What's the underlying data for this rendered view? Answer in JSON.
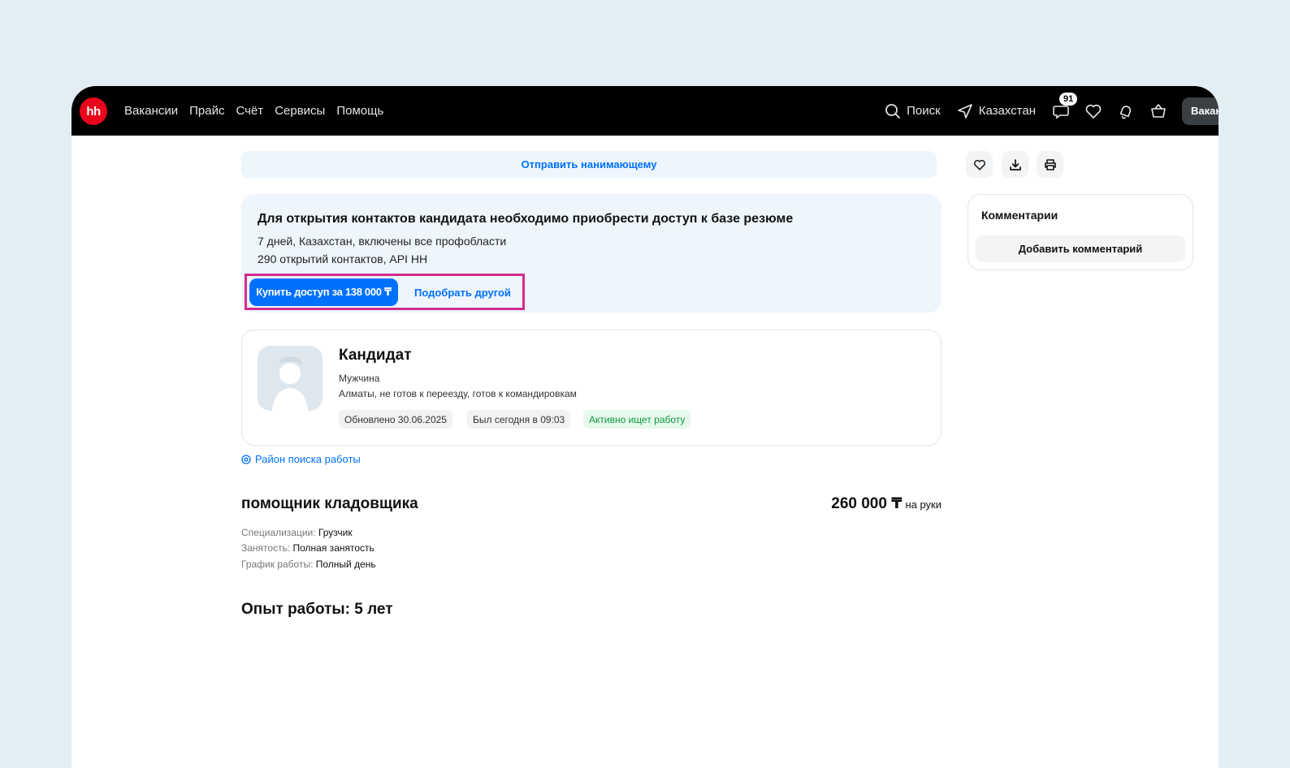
{
  "header": {
    "logo_text": "hh",
    "nav": [
      "Вакансии",
      "Прайс",
      "Счёт",
      "Сервисы",
      "Помощь"
    ],
    "search_label": "Поиск",
    "region_label": "Казахстан",
    "notifications_count": "91",
    "vacancies_button": "Вакансии"
  },
  "send_to_hirer": "Отправить нанимающему",
  "access": {
    "title": "Для открытия контактов кандидата необходимо приобрести доступ к базе резюме",
    "line1": "7 дней, Казахстан, включены все профобласти",
    "line2": "290 открытий контактов, API HH",
    "buy_button": "Купить доступ за 138 000 ₸",
    "choose_other": "Подобрать другой"
  },
  "candidate": {
    "name": "Кандидат",
    "gender": "Мужчина",
    "location": "Алматы, не готов к переезду, готов к командировкам",
    "updated": "Обновлено 30.06.2025",
    "last_seen": "Был сегодня в 09:03",
    "status": "Активно ищет работу"
  },
  "region_link": "Район поиска работы",
  "job": {
    "title": "помощник кладовщика",
    "salary": "260 000 ₸",
    "salary_note": "на руки",
    "spec_label": "Специализации:",
    "spec_value": "Грузчик",
    "employment_label": "Занятость:",
    "employment_value": "Полная занятость",
    "schedule_label": "График работы:",
    "schedule_value": "Полный день"
  },
  "experience": "Опыт работы: 5 лет",
  "comments": {
    "title": "Комментарии",
    "add_button": "Добавить комментарий"
  },
  "colors": {
    "accent": "#0070ff",
    "logo_red": "#e8051b",
    "highlight": "#d22c8c",
    "status_green": "#0a9a3e"
  }
}
